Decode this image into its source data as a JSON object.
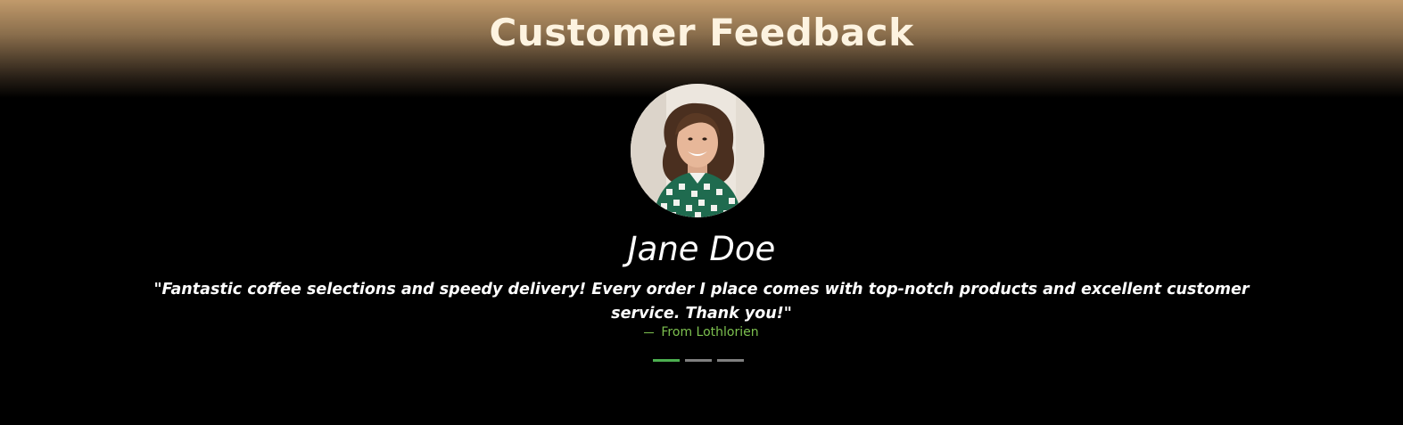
{
  "section": {
    "title": "Customer Feedback"
  },
  "testimonial": {
    "avatar_icon": "customer-portrait-image",
    "name": "Jane Doe",
    "quote": "\"Fantastic coffee selections and speedy delivery! Every order I place comes with top-notch products and excellent customer service. Thank you!\"",
    "source": "From Lothlorien"
  },
  "carousel": {
    "slide_count": 3,
    "active_index": 0
  },
  "colors": {
    "header_gradient_top": "#c19a6b",
    "title": "#fdf3e0",
    "background": "#000000",
    "accent_green": "#7cc04f",
    "indicator_active": "#4caf50",
    "indicator_inactive": "#7f7f7f"
  }
}
